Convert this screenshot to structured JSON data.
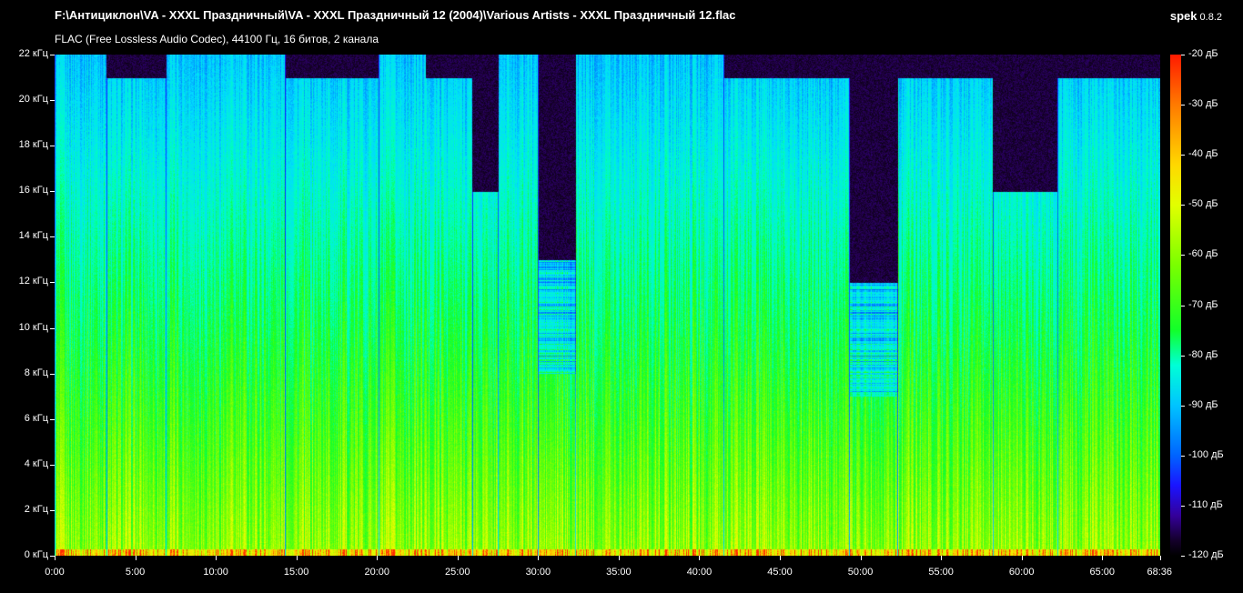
{
  "header": {
    "file_path": "F:\\Антициклон\\VA - XXXL Праздничный\\VA - XXXL Праздничный 12 (2004)\\Various Artists - XXXL Праздничный 12.flac",
    "stream_info": "FLAC (Free Lossless Audio Codec), 44100 Гц, 16 битов, 2 канала",
    "app_name": "spek",
    "app_version": "0.8.2"
  },
  "chart_data": {
    "type": "heatmap",
    "y_axis": {
      "unit": "кГц",
      "range": [
        0,
        22
      ],
      "ticks": [
        "0 кГц",
        "2 кГц",
        "4 кГц",
        "6 кГц",
        "8 кГц",
        "10 кГц",
        "12 кГц",
        "14 кГц",
        "16 кГц",
        "18 кГц",
        "20 кГц",
        "22 кГц"
      ]
    },
    "x_axis": {
      "range_seconds": [
        0,
        4116
      ],
      "ticks": [
        "0:00",
        "5:00",
        "10:00",
        "15:00",
        "20:00",
        "25:00",
        "30:00",
        "35:00",
        "40:00",
        "45:00",
        "50:00",
        "55:00",
        "60:00",
        "65:00",
        "68:36"
      ]
    },
    "color_scale": {
      "range_db": [
        -120,
        -20
      ],
      "ticks": [
        "-20 дБ",
        "-30 дБ",
        "-40 дБ",
        "-50 дБ",
        "-60 дБ",
        "-70 дБ",
        "-80 дБ",
        "-90 дБ",
        "-100 дБ",
        "-110 дБ",
        "-120 дБ"
      ]
    },
    "tracks": [
      {
        "start_min": 0.0,
        "end_min": 3.2,
        "cutoff_khz": 22
      },
      {
        "start_min": 3.2,
        "end_min": 6.9,
        "cutoff_khz": 21
      },
      {
        "start_min": 6.9,
        "end_min": 14.3,
        "cutoff_khz": 22
      },
      {
        "start_min": 14.3,
        "end_min": 20.1,
        "cutoff_khz": 21
      },
      {
        "start_min": 20.1,
        "end_min": 23.0,
        "cutoff_khz": 22
      },
      {
        "start_min": 23.0,
        "end_min": 25.9,
        "cutoff_khz": 21
      },
      {
        "start_min": 25.9,
        "end_min": 27.5,
        "cutoff_khz": 16
      },
      {
        "start_min": 27.5,
        "end_min": 30.0,
        "cutoff_khz": 22
      },
      {
        "start_min": 30.0,
        "end_min": 32.3,
        "cutoff_khz": 13
      },
      {
        "start_min": 32.3,
        "end_min": 41.5,
        "cutoff_khz": 22
      },
      {
        "start_min": 41.5,
        "end_min": 49.3,
        "cutoff_khz": 21
      },
      {
        "start_min": 49.3,
        "end_min": 52.3,
        "cutoff_khz": 12
      },
      {
        "start_min": 52.3,
        "end_min": 58.2,
        "cutoff_khz": 21
      },
      {
        "start_min": 58.2,
        "end_min": 62.2,
        "cutoff_khz": 16
      },
      {
        "start_min": 62.2,
        "end_min": 68.6,
        "cutoff_khz": 21
      }
    ]
  }
}
